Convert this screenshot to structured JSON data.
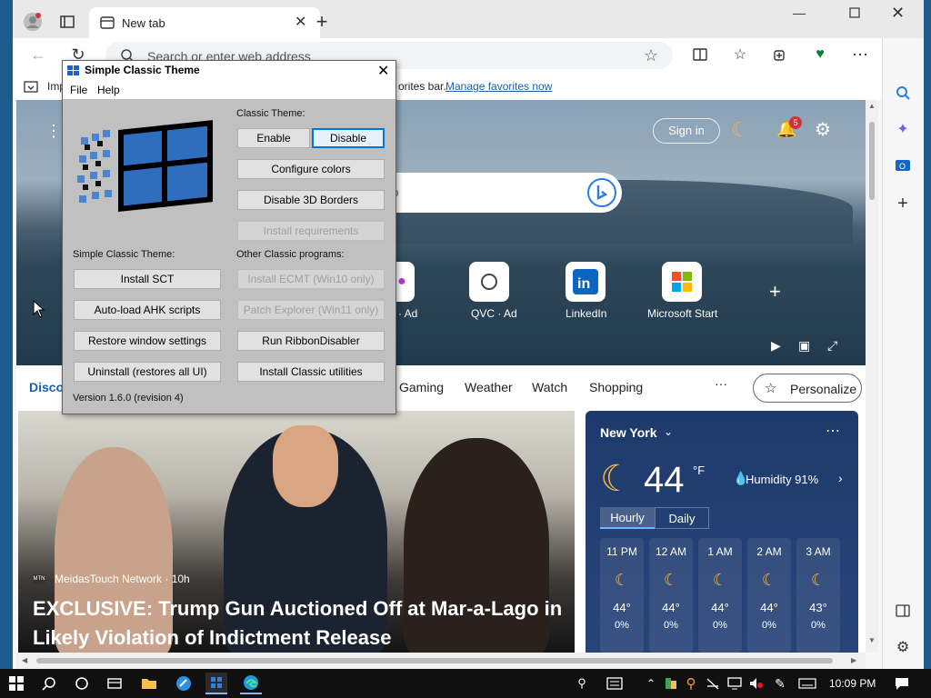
{
  "browser": {
    "tab_title": "New tab",
    "address_placeholder": "Search or enter web address",
    "favorites_import": "Imp",
    "favorites_text": "orites bar.",
    "favorites_link": "Manage favorites now"
  },
  "newtab": {
    "signin": "Sign in",
    "notifications_count": "5",
    "search_suffix": "eb",
    "tiles": [
      {
        "label": "ir · Ad"
      },
      {
        "label": "QVC · Ad"
      },
      {
        "label": "LinkedIn"
      },
      {
        "label": "Microsoft Start"
      }
    ],
    "nav": {
      "discover": "Disco",
      "items": [
        "Gaming",
        "Weather",
        "Watch",
        "Shopping"
      ],
      "more": "···",
      "personalize": "Personalize"
    },
    "news": {
      "source": "MeidasTouch Network · 10h",
      "title": "EXCLUSIVE: Trump Gun Auctioned Off at Mar-a-Lago in Likely Violation of Indictment Release"
    },
    "weather": {
      "city": "New York",
      "temp": "44",
      "unit": "°F",
      "humidity": "Humidity 91%",
      "tabs": [
        "Hourly",
        "Daily"
      ],
      "hours": [
        {
          "time": "11 PM",
          "temp": "44°",
          "precip": "0%"
        },
        {
          "time": "12 AM",
          "temp": "44°",
          "precip": "0%"
        },
        {
          "time": "1 AM",
          "temp": "44°",
          "precip": "0%"
        },
        {
          "time": "2 AM",
          "temp": "44°",
          "precip": "0%"
        },
        {
          "time": "3 AM",
          "temp": "43°",
          "precip": "0%"
        }
      ]
    }
  },
  "classic_window": {
    "title": "Simple Classic Theme",
    "menu": [
      "File",
      "Help"
    ],
    "classic_theme_label": "Classic Theme:",
    "enable": "Enable",
    "disable": "Disable",
    "configure_colors": "Configure colors",
    "disable_3d": "Disable 3D Borders",
    "install_requirements": "Install requirements",
    "sct_label": "Simple Classic Theme:",
    "other_label": "Other Classic programs:",
    "install_sct": "Install SCT",
    "autoload_ahk": "Auto-load AHK scripts",
    "restore_window": "Restore window settings",
    "uninstall": "Uninstall (restores all UI)",
    "install_ecmt": "Install ECMT (Win10 only)",
    "patch_explorer": "Patch Explorer (Win11 only)",
    "run_ribbon": "Run RibbonDisabler",
    "install_utilities": "Install Classic utilities",
    "version": "Version 1.6.0 (revision 4)"
  },
  "taskbar": {
    "clock": "10:09 PM"
  },
  "colors": {
    "accent": "#0078d7",
    "link": "#1a5fb4",
    "taskbar": "#101010",
    "classic_face": "#c0c0c0"
  }
}
